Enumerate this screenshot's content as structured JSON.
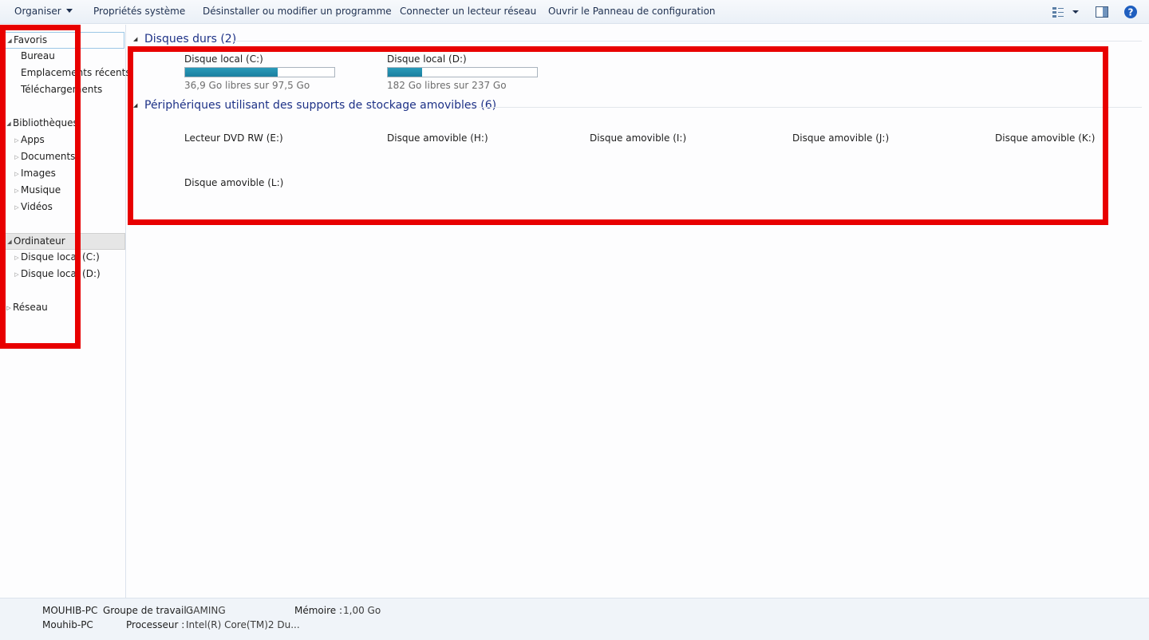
{
  "toolbar": {
    "organize": "Organiser",
    "system_properties": "Propriétés système",
    "uninstall": "Désinstaller ou modifier un programme",
    "map_drive": "Connecter un lecteur réseau",
    "control_panel": "Ouvrir le Panneau de configuration",
    "icons": [
      "view-options-icon",
      "preview-pane-icon",
      "help-icon"
    ]
  },
  "nav": {
    "favorites": "Favoris",
    "favorites_items": [
      "Bureau",
      "Emplacements récents",
      "Téléchargements"
    ],
    "libraries": "Bibliothèques",
    "libraries_items": [
      "Apps",
      "Documents",
      "Images",
      "Musique",
      "Vidéos"
    ],
    "computer": "Ordinateur",
    "computer_items": [
      "Disque local (C:)",
      "Disque local (D:)"
    ],
    "network": "Réseau"
  },
  "main": {
    "hard_disks_title": "Disques durs (2)",
    "drives": [
      {
        "name": "Disque local (C:)",
        "free_text": "36,9 Go libres sur 97,5 Go",
        "used_fraction": 0.62
      },
      {
        "name": "Disque local (D:)",
        "free_text": "182 Go libres sur 237 Go",
        "used_fraction": 0.23
      }
    ],
    "removable_title": "Périphériques utilisant des supports de stockage amovibles (6)",
    "removable": [
      "Lecteur DVD RW (E:)",
      "Disque amovible (H:)",
      "Disque amovible (I:)",
      "Disque amovible (J:)",
      "Disque amovible (K:)",
      "Disque amovible (L:)"
    ]
  },
  "details": {
    "computer_name": "MOUHIB-PC",
    "computer_label": "Mouhib-PC",
    "workgroup_label": "Groupe de travail :",
    "workgroup_value": "GAMING",
    "memory_label": "Mémoire :",
    "memory_value": "1,00 Go",
    "processor_label": "Processeur :",
    "processor_value": "Intel(R) Core(TM)2 Du..."
  },
  "colors": {
    "annotation": "#e80000",
    "drive_bar": "#1b80a0",
    "group_title": "#1e3287"
  }
}
